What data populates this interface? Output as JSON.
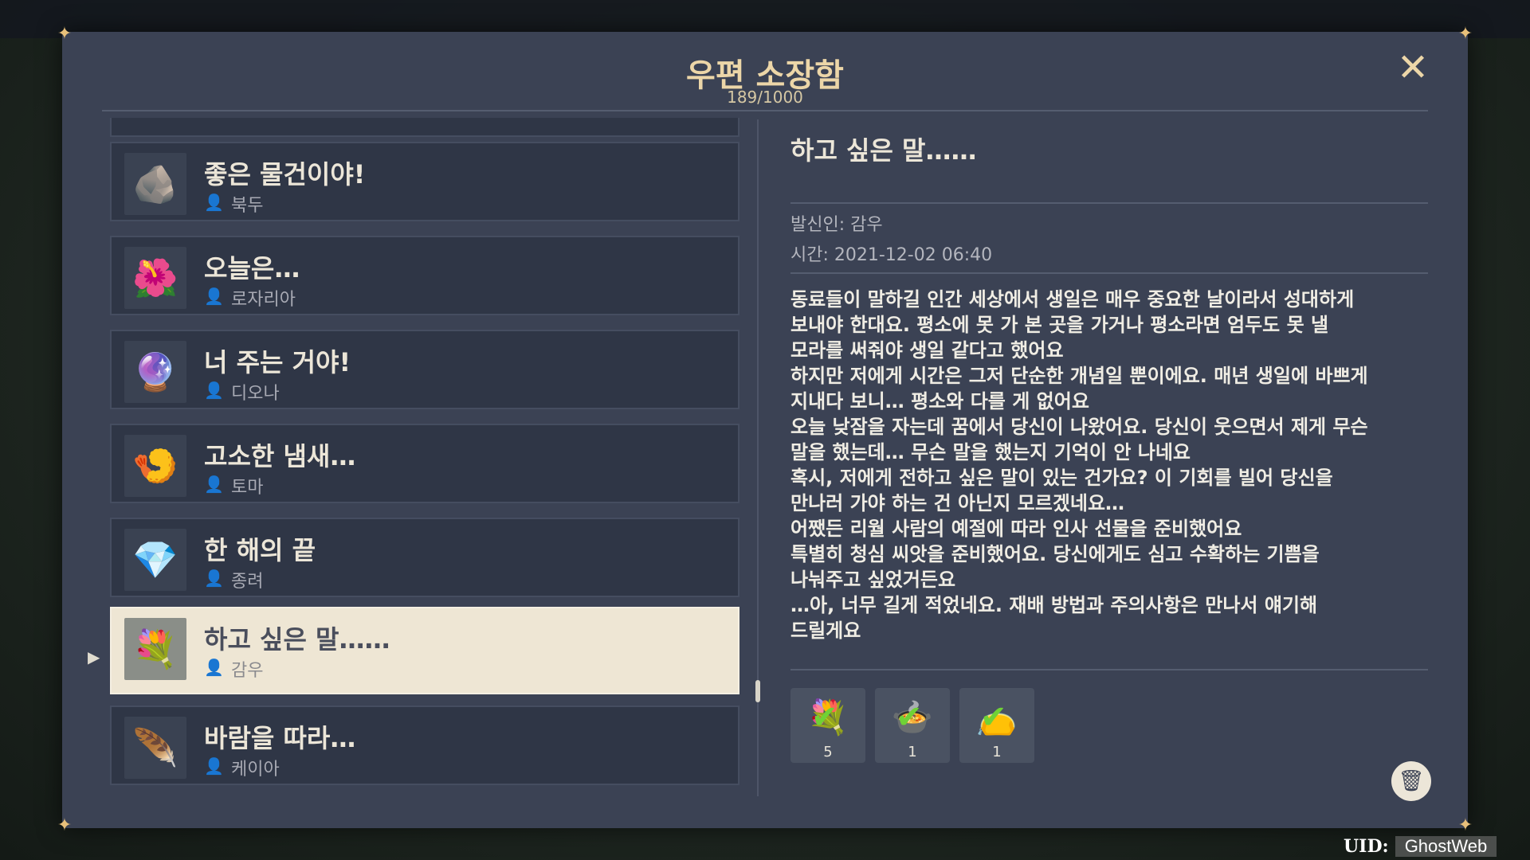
{
  "window": {
    "title": "우편 소장함",
    "count": "189/1000"
  },
  "mail_list": [
    {
      "title": "좋은 물건이야!",
      "sender": "북두",
      "icon": "ore-icon",
      "emoji": "🪨"
    },
    {
      "title": "오늘은…",
      "sender": "로자리아",
      "icon": "red-flower-icon",
      "emoji": "🌺"
    },
    {
      "title": "너 주는 거야!",
      "sender": "디오나",
      "icon": "orb-icon",
      "emoji": "🔮"
    },
    {
      "title": "고소한 냄새…",
      "sender": "토마",
      "icon": "dish-icon",
      "emoji": "🍤"
    },
    {
      "title": "한 해의 끝",
      "sender": "종려",
      "icon": "crystal-icon",
      "emoji": "💎"
    },
    {
      "title": "하고 싶은 말……",
      "sender": "감우",
      "icon": "white-flower-icon",
      "emoji": "💐",
      "selected": true
    },
    {
      "title": "바람을 따라…",
      "sender": "케이아",
      "icon": "wing-icon",
      "emoji": "🪶"
    }
  ],
  "detail": {
    "title": "하고 싶은 말……",
    "sender_line": "발신인: 감우",
    "time_line": "시간: 2021-12-02 06:40",
    "body": [
      "동료들이 말하길 인간 세상에서 생일은 매우 중요한 날이라서 성대하게",
      "보내야 한대요. 평소에 못 가 본 곳을 가거나 평소라면 엄두도 못 낼",
      "모라를 써줘야 생일 같다고 했어요",
      "하지만 저에게 시간은 그저 단순한 개념일 뿐이에요. 매년 생일에 바쁘게",
      "지내다 보니… 평소와 다를 게 없어요",
      "오늘 낮잠을 자는데 꿈에서 당신이 나왔어요. 당신이 웃으면서 제게 무슨",
      "말을 했는데… 무슨 말을 했는지 기억이 안 나네요",
      "혹시, 저에게 전하고 싶은 말이 있는 건가요? 이 기회를 빌어 당신을",
      "만나러 가야 하는 건 아닌지 모르겠네요…",
      "어쨌든 리월 사람의 예절에 따라 인사 선물을 준비했어요",
      "특별히 청심 씨앗을 준비했어요. 당신에게도 심고 수확하는 기쁨을",
      "나눠주고 싶었거든요",
      "…아, 너무 길게 적었네요. 재배 방법과 주의사항은 만나서 얘기해",
      "드릴게요"
    ],
    "attachments": [
      {
        "icon": "qingxin-flower-icon",
        "emoji": "💐",
        "qty": "5"
      },
      {
        "icon": "food-plate-icon",
        "emoji": "🍲",
        "qty": "1"
      },
      {
        "icon": "seed-bag-icon",
        "emoji": "👝",
        "qty": "1"
      }
    ]
  },
  "uid": {
    "label": "UID:",
    "value": "GhostWeb"
  }
}
